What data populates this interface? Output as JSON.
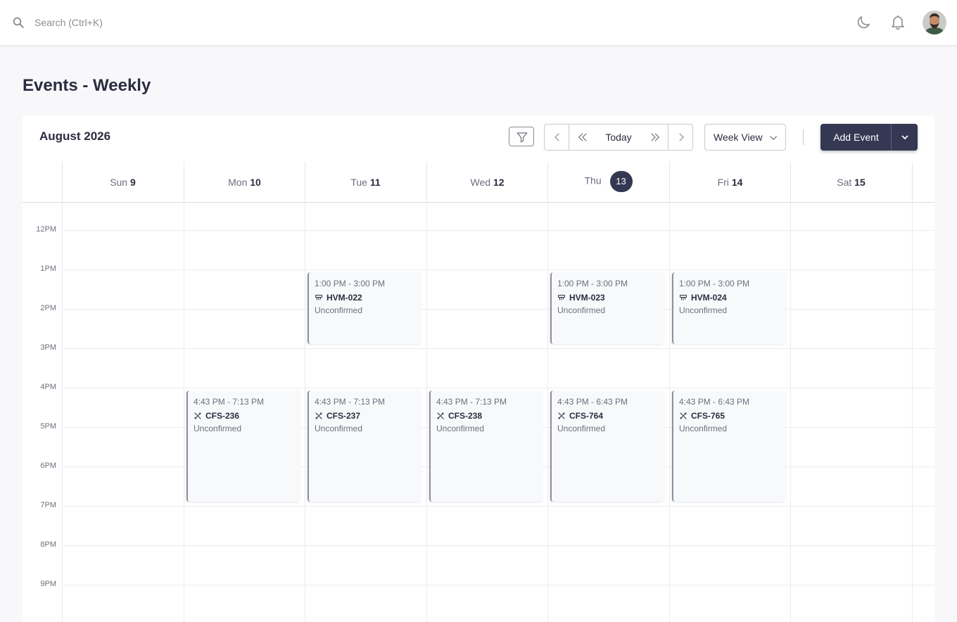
{
  "topbar": {
    "search_placeholder": "Search (Ctrl+K)"
  },
  "page": {
    "title": "Events - Weekly"
  },
  "calendar": {
    "month": "August 2026",
    "today_label": "Today",
    "view_label": "Week View",
    "add_label": "Add Event",
    "days": [
      {
        "dow": "Sun",
        "num": "9"
      },
      {
        "dow": "Mon",
        "num": "10"
      },
      {
        "dow": "Tue",
        "num": "11"
      },
      {
        "dow": "Wed",
        "num": "12"
      },
      {
        "dow": "Thu",
        "num": "13",
        "today": true
      },
      {
        "dow": "Fri",
        "num": "14"
      },
      {
        "dow": "Sat",
        "num": "15"
      }
    ],
    "hours": [
      "12PM",
      "1PM",
      "2PM",
      "3PM",
      "4PM",
      "5PM",
      "6PM",
      "7PM",
      "8PM",
      "9PM"
    ],
    "events": [
      {
        "time": "1:00 PM - 3:00 PM",
        "title": "HVM-022",
        "status": "Unconfirmed",
        "icon": "vacuum-icon"
      },
      {
        "time": "1:00 PM - 3:00 PM",
        "title": "HVM-023",
        "status": "Unconfirmed",
        "icon": "vacuum-icon"
      },
      {
        "time": "1:00 PM - 3:00 PM",
        "title": "HVM-024",
        "status": "Unconfirmed",
        "icon": "vacuum-icon"
      },
      {
        "time": "4:43 PM - 7:13 PM",
        "title": "CFS-236",
        "status": "Unconfirmed",
        "icon": "tools-icon"
      },
      {
        "time": "4:43 PM - 7:13 PM",
        "title": "CFS-237",
        "status": "Unconfirmed",
        "icon": "tools-icon"
      },
      {
        "time": "4:43 PM - 7:13 PM",
        "title": "CFS-238",
        "status": "Unconfirmed",
        "icon": "tools-icon"
      },
      {
        "time": "4:43 PM - 6:43 PM",
        "title": "CFS-764",
        "status": "Unconfirmed",
        "icon": "tools-icon"
      },
      {
        "time": "4:43 PM - 6:43 PM",
        "title": "CFS-765",
        "status": "Unconfirmed",
        "icon": "tools-icon"
      }
    ]
  },
  "colors": {
    "accent": "#353852",
    "page_bg": "#f8f8fa",
    "event_bg": "#f8f9fb"
  }
}
